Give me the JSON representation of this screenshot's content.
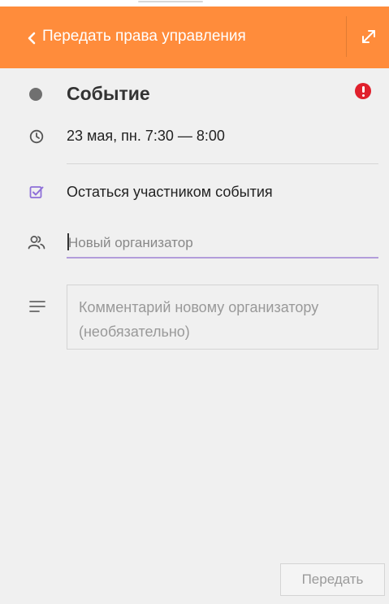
{
  "header": {
    "title": "Передать права управления",
    "back_icon": "chevron-left-icon",
    "expand_icon": "expand-icon",
    "background_color": "#ff8c3b"
  },
  "event": {
    "title": "Событие",
    "date_time": "23 мая, пн. 7:30 — 8:00",
    "status_color": "#707070",
    "alert_color": "#e0202c"
  },
  "form": {
    "stay_participant_label": "Остаться участником события",
    "stay_participant_checked": true,
    "checkbox_color": "#8e6fd8",
    "organizer_placeholder": "Новый организатор",
    "organizer_value": "",
    "comment_placeholder": "Комментарий новому организатору (необязательно)",
    "comment_value": ""
  },
  "footer": {
    "submit_label": "Передать",
    "submit_enabled": false
  }
}
